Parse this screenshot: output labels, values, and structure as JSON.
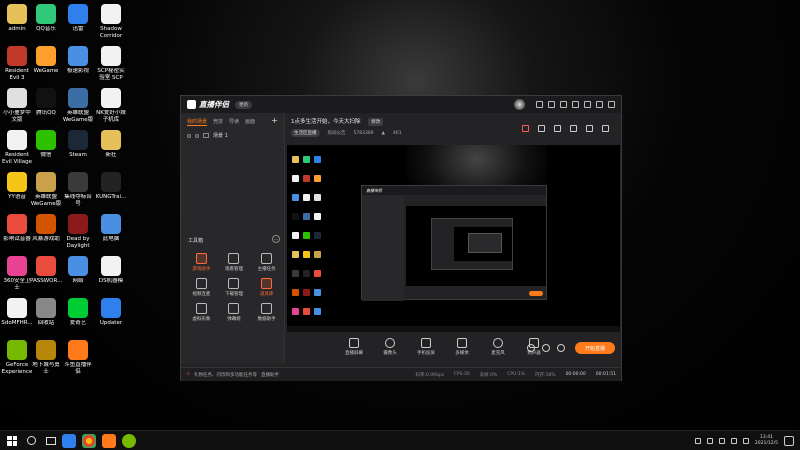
{
  "desktop": {
    "icons": [
      {
        "label": "admin",
        "color": "#e6c15a"
      },
      {
        "label": "QQ音乐",
        "color": "#32c87a"
      },
      {
        "label": "迅雷",
        "color": "#2f80ed"
      },
      {
        "label": "Shadow Corridor",
        "color": "#f2f2f2"
      },
      {
        "label": "Resident Evil 3",
        "color": "#c0392b"
      },
      {
        "label": "WeGame",
        "color": "#ff9f2e"
      },
      {
        "label": "极速影视",
        "color": "#4a90e2"
      },
      {
        "label": "SCP秘密实验室 SCP Se...",
        "color": "#f2f2f2"
      },
      {
        "label": "小小噩梦中文版",
        "color": "#e0e0e0"
      },
      {
        "label": "腾讯QQ",
        "color": "#111111"
      },
      {
        "label": "英雄联盟 WeGame版",
        "color": "#3a6ea5"
      },
      {
        "label": "NK爱好小妹子机库",
        "color": "#f2f2f2"
      },
      {
        "label": "Resident Evil Village",
        "color": "#f2f2f2"
      },
      {
        "label": "微信",
        "color": "#2dc100"
      },
      {
        "label": "Steam",
        "color": "#1b2838"
      },
      {
        "label": "新狂",
        "color": "#e6c15a"
      },
      {
        "label": "YY语音",
        "color": "#f5c518"
      },
      {
        "label": "英雄联盟 WeGame版",
        "color": "#c9a14a"
      },
      {
        "label": "集线夺标合号",
        "color": "#3a3a3a"
      },
      {
        "label": "KUNGTrai...",
        "color": "#222222"
      },
      {
        "label": "影响试音器",
        "color": "#e94b3c"
      },
      {
        "label": "风暴游戏助",
        "color": "#d35400"
      },
      {
        "label": "Dead by Daylight",
        "color": "#8b1a1a"
      },
      {
        "label": "此电脑",
        "color": "#4a90e2"
      },
      {
        "label": "360安全卫士",
        "color": "#e84393"
      },
      {
        "label": "PASSWOR...",
        "color": "#e94b3c"
      },
      {
        "label": "网络",
        "color": "#4a90e2"
      },
      {
        "label": "DS机器模",
        "color": "#f2f2f2"
      },
      {
        "label": "SdoMFHR...",
        "color": "#f2f2f2"
      },
      {
        "label": "回收站",
        "color": "#888888"
      },
      {
        "label": "爱奇艺",
        "color": "#00cc36"
      },
      {
        "label": "Updater",
        "color": "#2f80ed"
      },
      {
        "label": "GeForce Experience",
        "color": "#76b900"
      },
      {
        "label": "地下城与勇士",
        "color": "#b8860b"
      },
      {
        "label": "斗鱼直播伴侣",
        "color": "#ff7a1a"
      }
    ]
  },
  "app": {
    "name": "直播伴侣",
    "version_badge": "更新",
    "tabs": [
      "我的场景",
      "竞技",
      "导读",
      "画面"
    ],
    "scene_name": "场景 1",
    "tools_header": "工具箱",
    "tools": [
      {
        "label": "游戏助手",
        "highlight": true
      },
      {
        "label": "观看管理",
        "highlight": false
      },
      {
        "label": "主播任务",
        "highlight": false
      },
      {
        "label": "视频连麦",
        "highlight": false
      },
      {
        "label": "下载管理",
        "highlight": false
      },
      {
        "label": "道具库",
        "highlight": true
      },
      {
        "label": "虚拟形象",
        "highlight": false
      },
      {
        "label": "弹幕姬",
        "highlight": false
      },
      {
        "label": "数据助手",
        "highlight": false
      }
    ],
    "stream_title": "1点多生活开始，今天大扫除",
    "edit_button": "修改",
    "category": "生活区直播",
    "room_label": "房间公告",
    "room_id": "5783389",
    "heat": "461",
    "bottom_tools": [
      {
        "label": "直播屏幕"
      },
      {
        "label": "摄像头"
      },
      {
        "label": "手机投屏"
      },
      {
        "label": "多媒体"
      },
      {
        "label": "麦克风"
      },
      {
        "label": "扬声器"
      }
    ],
    "start_button": "开始直播",
    "status": {
      "alert": "礼物任务、闪烁和多功能任务等",
      "link": "直播助手",
      "stats": [
        "码率:0.0Kbps",
        "FPS:30",
        "丢帧:0%",
        "CPU:1%",
        "内存:38%"
      ],
      "timer1": "00:00:00",
      "timer2": "00:01:51"
    }
  },
  "taskbar": {
    "time": "13:41",
    "date": "2021/12/5"
  }
}
